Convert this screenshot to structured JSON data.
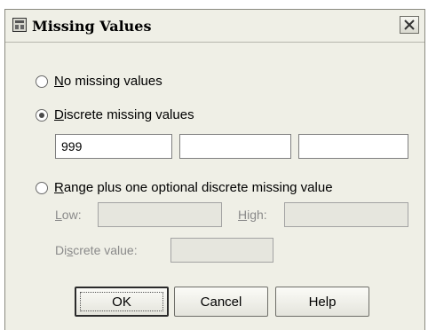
{
  "window": {
    "title": "Missing Values",
    "icon": "spss-dialog-icon",
    "close_icon": "close-icon"
  },
  "options": {
    "no_missing": {
      "key": "N",
      "rest": "o missing values",
      "checked": false
    },
    "discrete": {
      "key": "D",
      "rest": "iscrete missing values",
      "checked": true
    },
    "range": {
      "key": "R",
      "rest": "ange plus one optional discrete missing value",
      "checked": false
    }
  },
  "discrete_fields": {
    "value1": "999",
    "value2": "",
    "value3": ""
  },
  "range_fields": {
    "low_key": "L",
    "low_rest": "ow:",
    "high_key": "H",
    "high_rest": "igh:",
    "discrete_pre": "Di",
    "discrete_key": "s",
    "discrete_post": "crete value:",
    "low_value": "",
    "high_value": "",
    "discrete_value": ""
  },
  "buttons": {
    "ok": "OK",
    "cancel": "Cancel",
    "help": "Help"
  }
}
